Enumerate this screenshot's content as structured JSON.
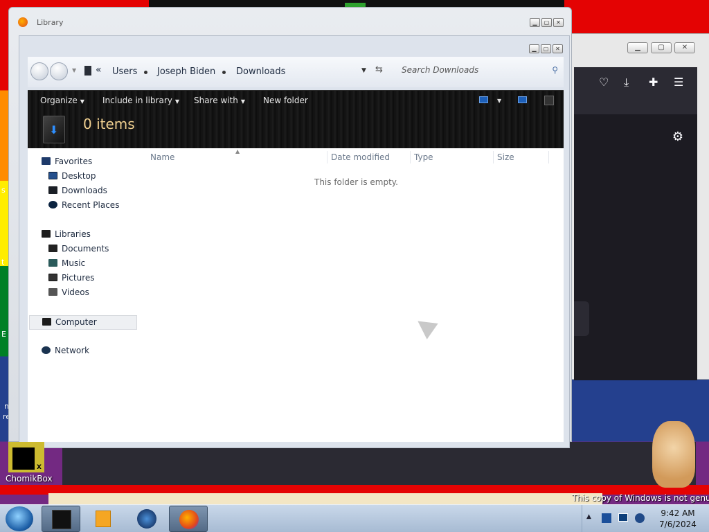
{
  "desktop": {
    "icon_label": "ChomikBox",
    "genuine_notice": "This copy of Windows is not genuine",
    "edge_fragments": [
      "s",
      "t",
      "E",
      "n",
      "re"
    ]
  },
  "window": {
    "title": "Library"
  },
  "address": {
    "prefix": "«",
    "crumbs": [
      "Users",
      "Joseph Biden",
      "Downloads"
    ],
    "search_placeholder": "Search Downloads"
  },
  "toolbar": {
    "organize": "Organize",
    "include": "Include in library",
    "share": "Share with",
    "new_folder": "New folder"
  },
  "details": {
    "count": "0 items"
  },
  "navpane": {
    "favorites": "Favorites",
    "desktop": "Desktop",
    "downloads": "Downloads",
    "recent": "Recent Places",
    "libraries": "Libraries",
    "documents": "Documents",
    "music": "Music",
    "pictures": "Pictures",
    "videos": "Videos",
    "computer": "Computer",
    "network": "Network"
  },
  "columns": [
    "Name",
    "Date modified",
    "Type",
    "Size"
  ],
  "empty_message": "This folder is empty.",
  "clock": {
    "time": "9:42 AM",
    "date": "7/6/2024"
  },
  "colors": {
    "toolbar_bg": "#151515",
    "count_text": "#f0d090",
    "taskbar": "#b7c9de"
  }
}
